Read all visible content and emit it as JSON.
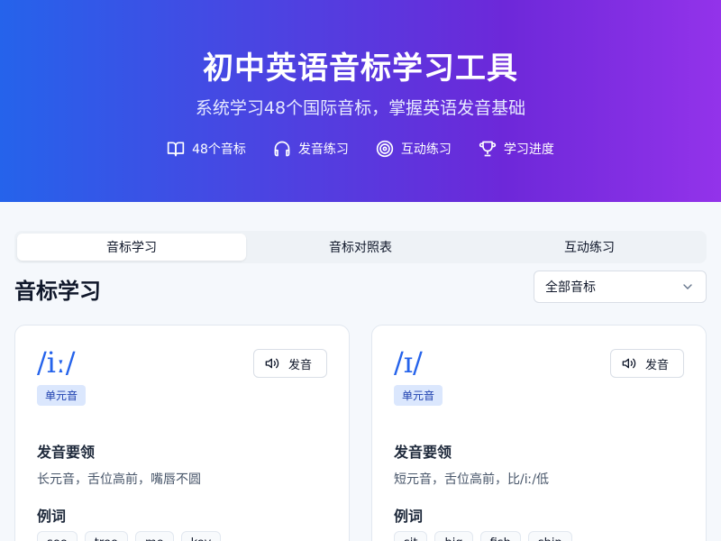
{
  "header": {
    "title": "初中英语音标学习工具",
    "subtitle": "系统学习48个国际音标，掌握英语发音基础",
    "features": [
      {
        "icon": "book-icon",
        "label": "48个音标"
      },
      {
        "icon": "headphones-icon",
        "label": "发音练习"
      },
      {
        "icon": "target-icon",
        "label": "互动练习"
      },
      {
        "icon": "trophy-icon",
        "label": "学习进度"
      }
    ]
  },
  "tabs": [
    {
      "label": "音标学习",
      "active": true
    },
    {
      "label": "音标对照表",
      "active": false
    },
    {
      "label": "互动练习",
      "active": false
    }
  ],
  "section": {
    "title": "音标学习",
    "filter_value": "全部音标"
  },
  "cards": [
    {
      "symbol": "/iː/",
      "badge": "单元音",
      "play_label": "发音",
      "tips_label": "发音要领",
      "tips": "长元音，舌位高前，嘴唇不圆",
      "examples_label": "例词",
      "examples": [
        "see",
        "tree",
        "me",
        "key"
      ]
    },
    {
      "symbol": "/ɪ/",
      "badge": "单元音",
      "play_label": "发音",
      "tips_label": "发音要领",
      "tips": "短元音，舌位高前，比/iː/低",
      "examples_label": "例词",
      "examples": [
        "sit",
        "big",
        "fish",
        "ship"
      ]
    }
  ],
  "colors": {
    "accent": "#2563eb",
    "gradient_start": "#2563eb",
    "gradient_end": "#9333ea"
  }
}
